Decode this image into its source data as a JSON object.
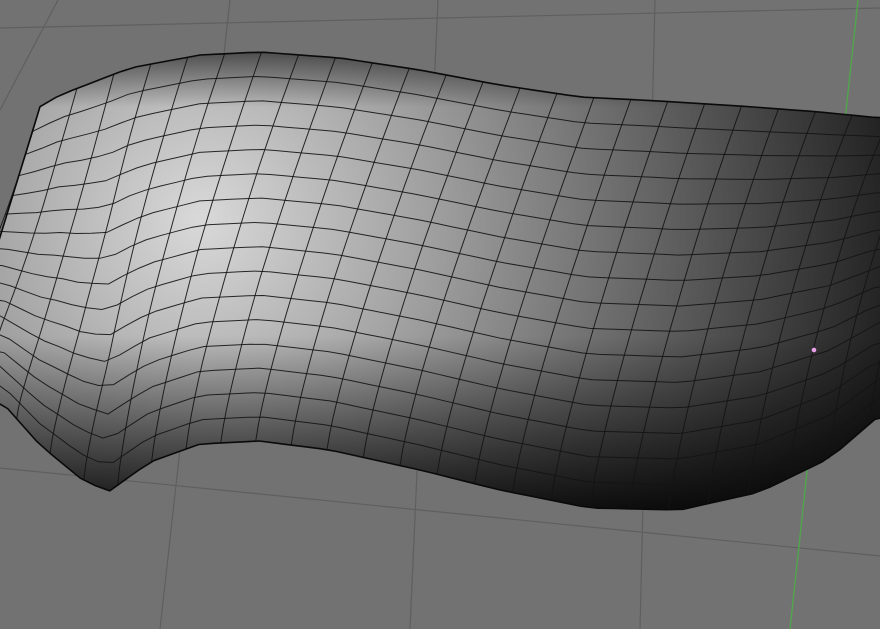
{
  "viewport": {
    "name": "3D Viewport",
    "background_color": "#727272",
    "floor_grid_color": "#5f5f5f",
    "y_axis_color": "#4fa84a",
    "mesh_edge_color": "#141414",
    "mesh_shade_light": "#d9d9d9",
    "mesh_shade_dark": "#0a0a0a",
    "selected_vertex_color": "#e8a2e8"
  },
  "mesh": {
    "object": "subdivided-curved-plane",
    "shading": "smooth",
    "wireframe_overlay": true,
    "edge_loops_u": 26,
    "edge_loops_v": 16
  },
  "selection": {
    "selected_vertices": 1
  }
}
